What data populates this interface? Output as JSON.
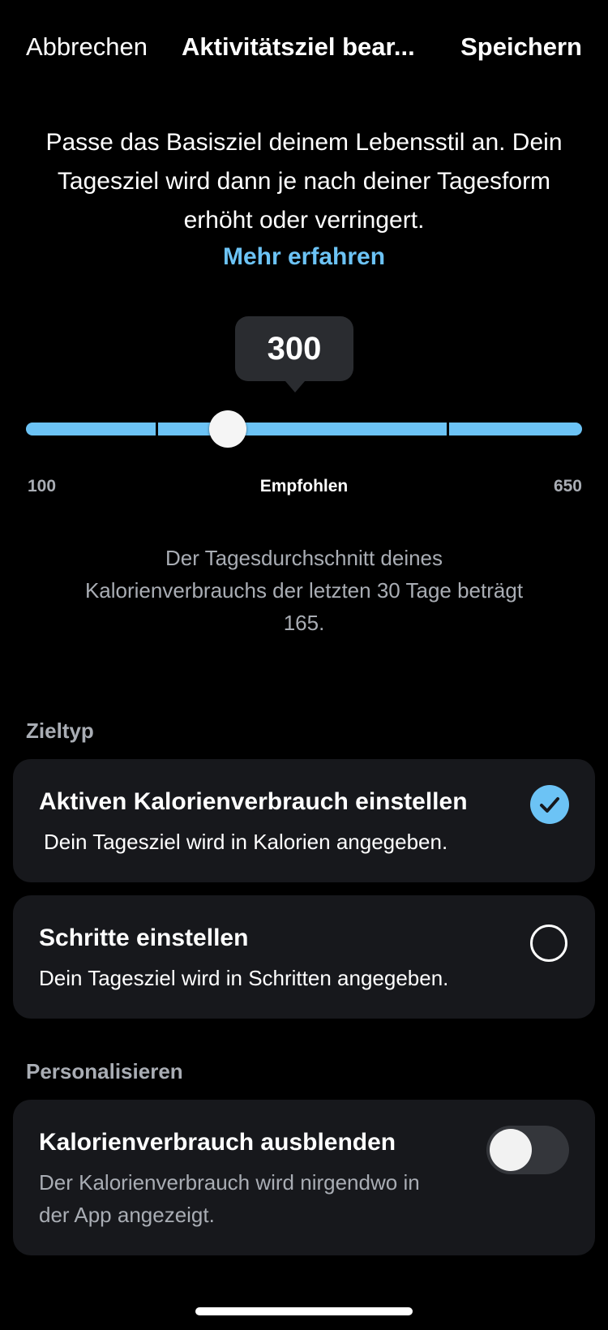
{
  "nav": {
    "cancel_label": "Abbrechen",
    "title": "Aktivitätsziel bear...",
    "save_label": "Speichern"
  },
  "intro": {
    "text": "Passe das Basisziel deinem Lebensstil an. Dein Tagesziel wird dann je nach deiner Tagesform erhöht oder verringert.",
    "link_label": "Mehr erfahren"
  },
  "slider": {
    "value": 300,
    "value_label": "300",
    "min": 100,
    "max": 650,
    "min_label": "100",
    "max_label": "650",
    "recommended_label": "Empfohlen",
    "accent_color": "#6cc3f5"
  },
  "average_text": "Der Tagesdurchschnitt deines Kalorienverbrauchs der letzten 30 Tage beträgt 165.",
  "goal_type": {
    "section_label": "Zieltyp",
    "options": [
      {
        "title": "Aktiven Kalorienverbrauch einstellen",
        "subtitle": "Dein Tagesziel wird in Kalorien angegeben.",
        "selected": true,
        "icon": "check-circle-icon"
      },
      {
        "title": "Schritte einstellen",
        "subtitle": "Dein Tagesziel wird in Schritten angegeben.",
        "selected": false,
        "icon": "radio-circle-icon"
      }
    ]
  },
  "personalize": {
    "section_label": "Personalisieren",
    "toggle_title": "Kalorienverbrauch ausblenden",
    "toggle_subtitle": "Der Kalorienverbrauch wird nirgendwo in der App angezeigt.",
    "toggle_on": false
  }
}
